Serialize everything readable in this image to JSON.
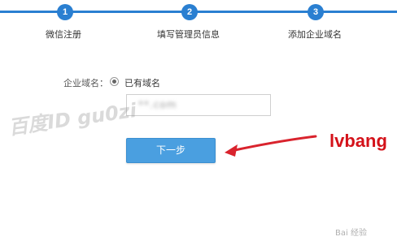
{
  "steps": [
    {
      "number": "1",
      "label": "微信注册"
    },
    {
      "number": "2",
      "label": "填写管理员信息"
    },
    {
      "number": "3",
      "label": "添加企业域名"
    }
  ],
  "form": {
    "domain_label": "企业域名：",
    "radio_option": "已有域名",
    "domain_value": "**.com",
    "next_button": "下一步"
  },
  "overlay": {
    "watermark": "百度ID gu0zi",
    "brand": "lvbang",
    "baidu": "Bai 经验"
  },
  "colors": {
    "accent": "#2a7fd1",
    "button": "#4a9fe0",
    "arrow": "#d9232d",
    "brand": "#d4121a"
  }
}
